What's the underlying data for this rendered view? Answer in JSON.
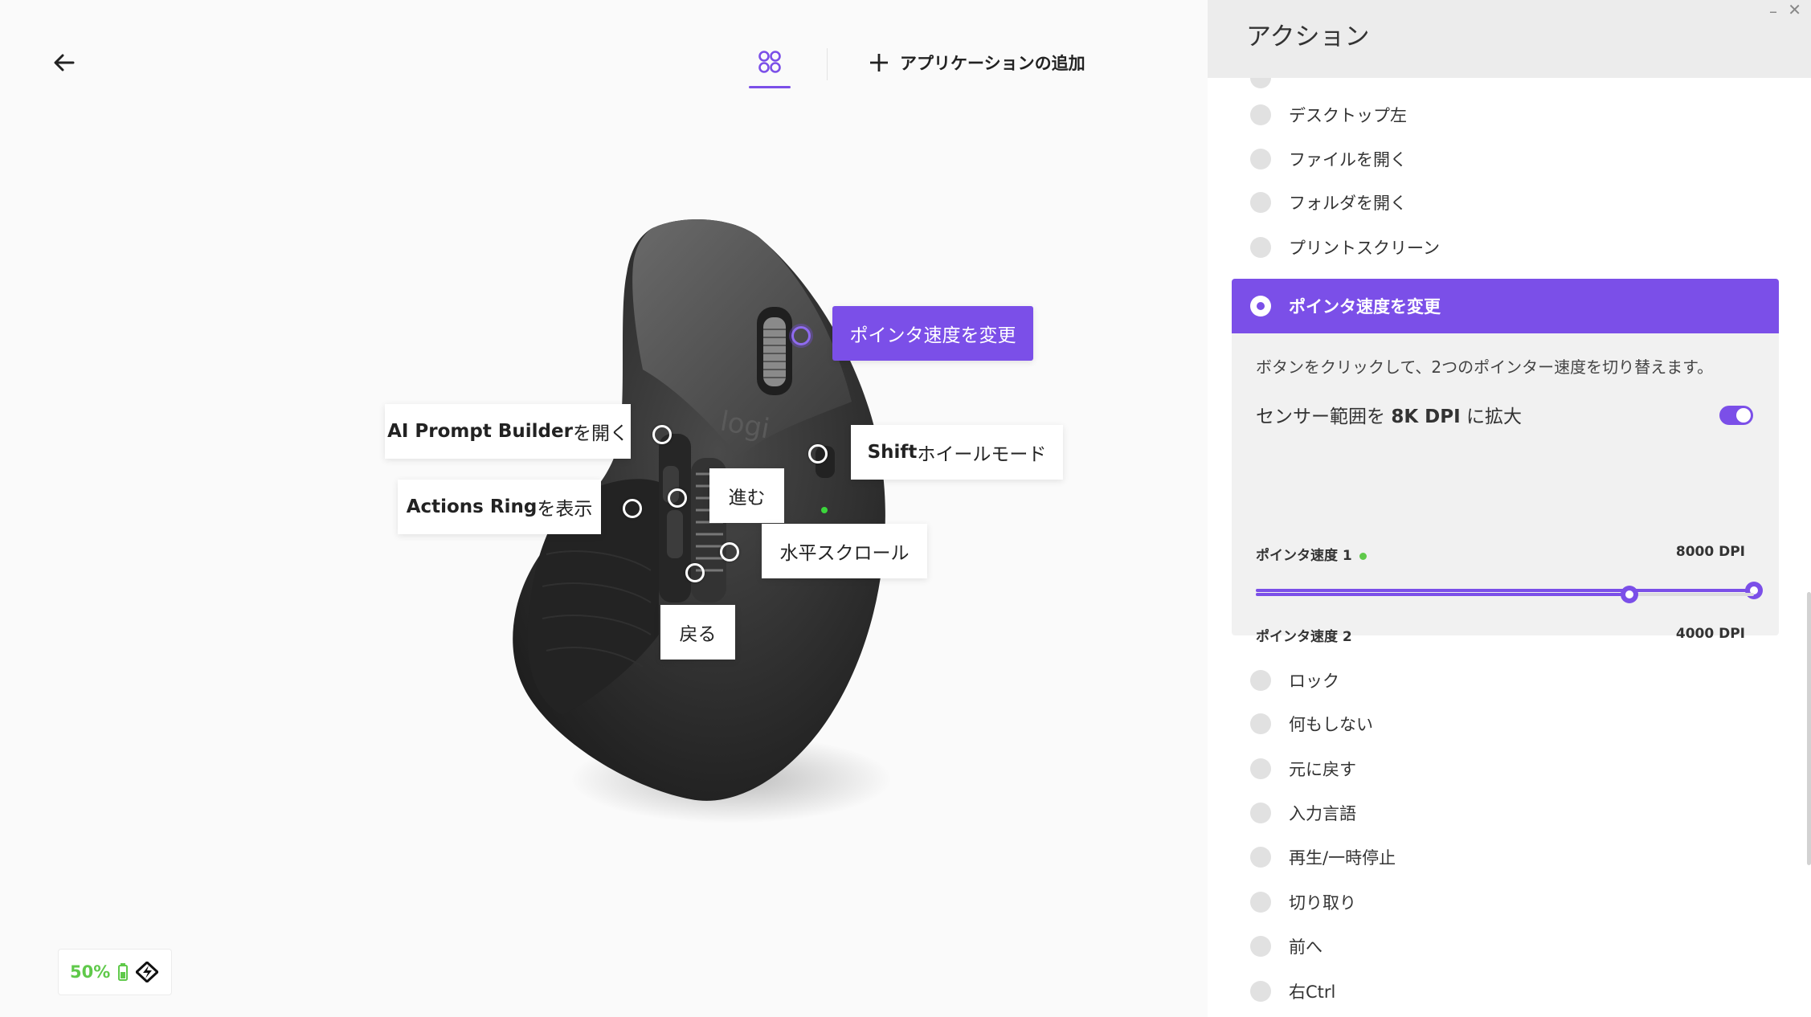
{
  "header": {
    "add_app_label": "アプリケーションの追加"
  },
  "callouts": {
    "pointer_speed": "ポインタ速度を変更",
    "ai_prompt_bold": "AI Prompt Builder",
    "ai_prompt_rest": "を開く",
    "shift_bold": "Shift",
    "shift_rest": " ホイールモード",
    "actions_ring_bold": "Actions Ring",
    "actions_ring_rest": "を表示",
    "forward": "進む",
    "horizontal_scroll": "水平スクロール",
    "back": "戻る"
  },
  "battery": {
    "percent": "50%"
  },
  "panel": {
    "title": "アクション",
    "actions_above": [
      "デスクトップ左",
      "ファイルを開く",
      "フォルダを開く",
      "プリントスクリーン"
    ],
    "selected": {
      "label": "ポインタ速度を変更",
      "description": "ボタンをクリックして、2つのポインター速度を切り替えます。",
      "sensor_prefix": "センサー範囲を ",
      "sensor_bold": "8K DPI",
      "sensor_suffix": " に拡大",
      "sensor_toggle_on": true,
      "speed1_label": "ポインタ速度 1",
      "speed1_value": "8000 DPI",
      "speed1_fraction": 1.0,
      "speed2_label": "ポインタ速度 2",
      "speed2_value": "4000 DPI",
      "speed2_fraction": 0.75
    },
    "actions_below": [
      "ロック",
      "何もしない",
      "元に戻す",
      "入力言語",
      "再生/一時停止",
      "切り取り",
      "前へ",
      "右Ctrl"
    ]
  },
  "colors": {
    "accent": "#7b4fe8",
    "battery_green": "#5fc94a"
  }
}
